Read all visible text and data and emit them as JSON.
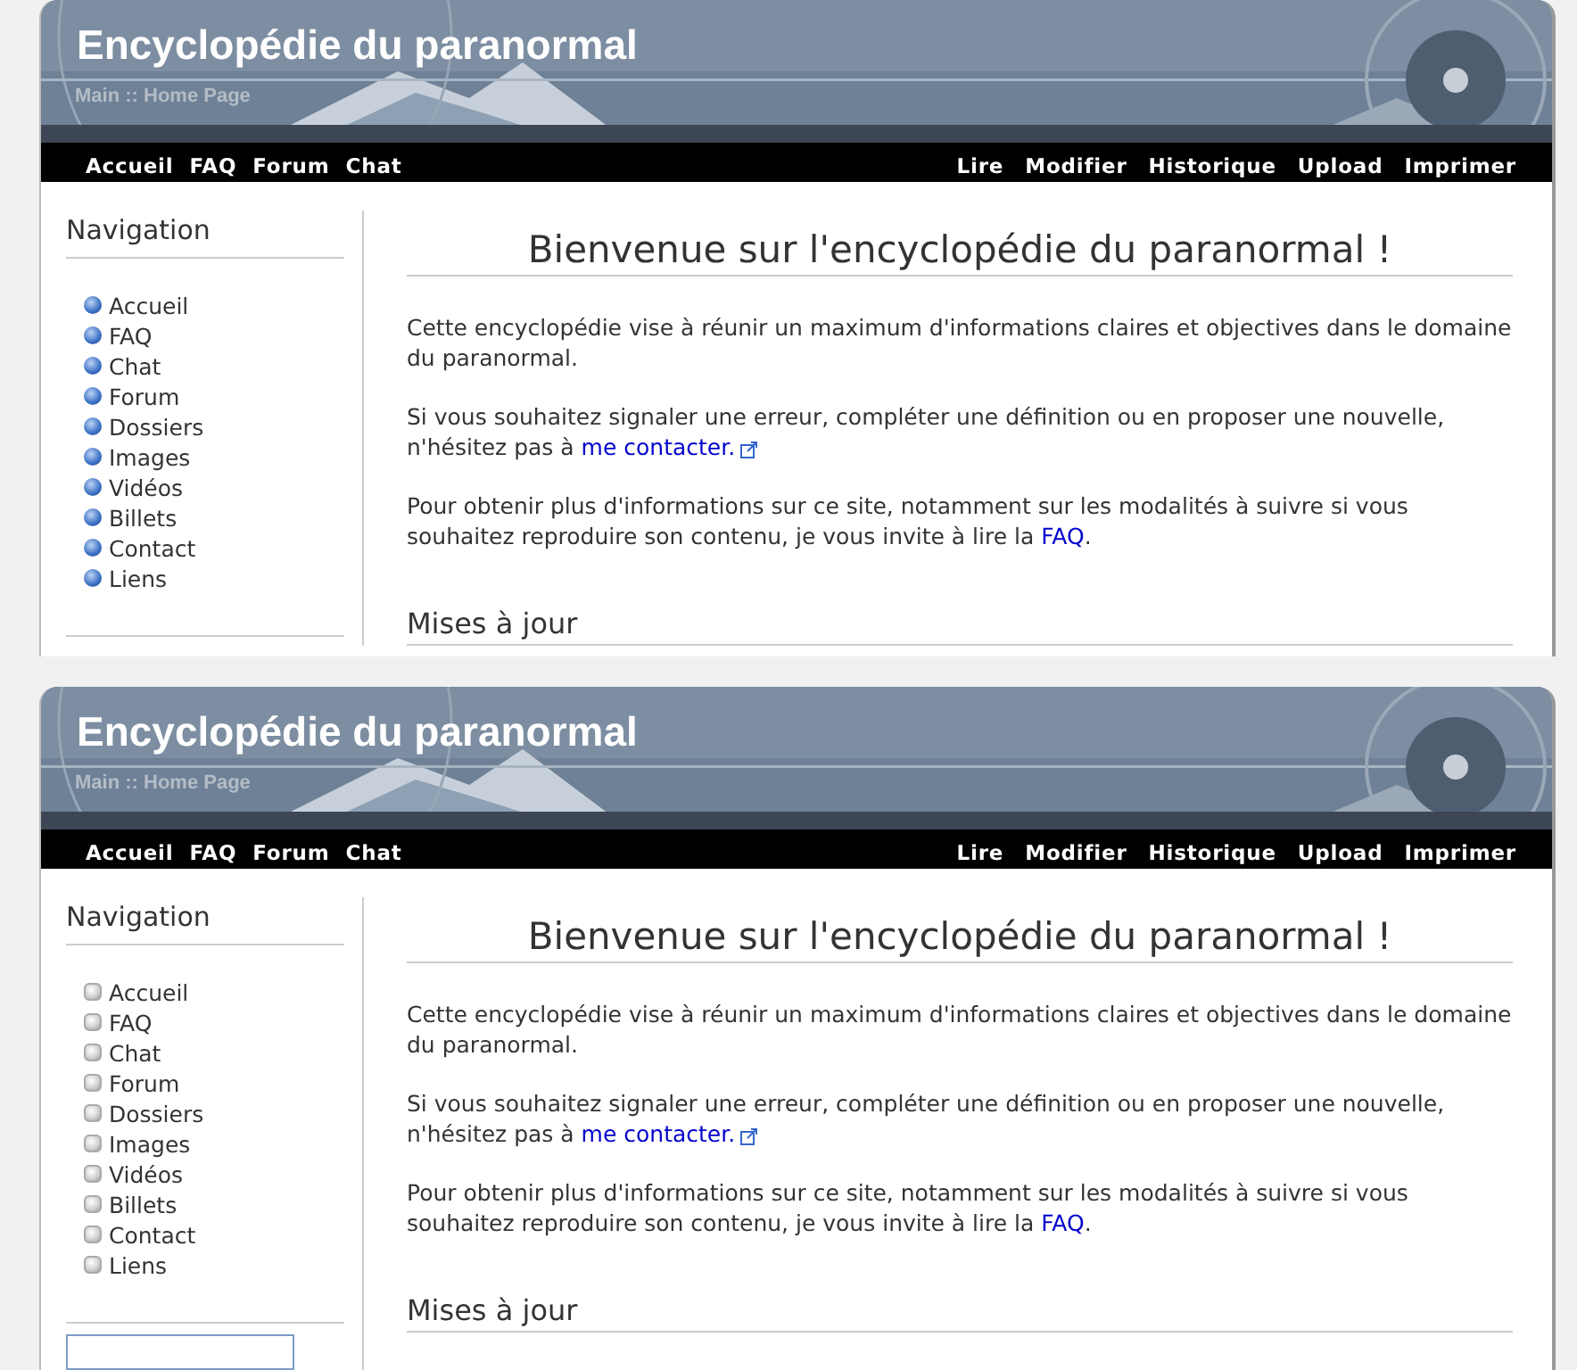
{
  "panels": [
    {
      "kind": "colored",
      "site_title": "Encyclopédie du paranormal",
      "breadcrumb": "Main :: Home Page",
      "top_nav_left": [
        "Accueil",
        "FAQ",
        "Forum",
        "Chat"
      ],
      "top_nav_right": [
        "Lire",
        "Modifier",
        "Historique",
        "Upload",
        "Imprimer"
      ],
      "sidebar": {
        "title": "Navigation",
        "items": [
          "Accueil",
          "FAQ",
          "Chat",
          "Forum",
          "Dossiers",
          "Images",
          "Vidéos",
          "Billets",
          "Contact",
          "Liens"
        ]
      },
      "heading": "Bienvenue sur l'encyclopédie du paranormal !",
      "paragraphs": [
        {
          "text": "Cette encyclopédie vise à réunir un maximum d'informations claires et objectives dans le domaine du paranormal."
        },
        {
          "text": "Si vous souhaitez signaler une erreur, compléter une définition ou en proposer une nouvelle, n'hésitez pas à ",
          "link": "me contacter.",
          "external": true
        },
        {
          "text": "Pour obtenir plus d'informations sur ce site, notamment sur les modalités à suivre si vous souhaitez reproduire son contenu, je vous invite à lire la ",
          "link": "FAQ",
          "external": false,
          "after": "."
        }
      ],
      "subheading": "Mises à jour"
    },
    {
      "kind": "plain",
      "site_title": "Encyclopédie du paranormal",
      "breadcrumb": "Main :: Home Page",
      "top_nav_left": [
        "Accueil",
        "FAQ",
        "Forum",
        "Chat"
      ],
      "top_nav_right": [
        "Lire",
        "Modifier",
        "Historique",
        "Upload",
        "Imprimer"
      ],
      "sidebar": {
        "title": "Navigation",
        "items": [
          "Accueil",
          "FAQ",
          "Chat",
          "Forum",
          "Dossiers",
          "Images",
          "Vidéos",
          "Billets",
          "Contact",
          "Liens"
        ],
        "search_field": true
      },
      "heading": "Bienvenue sur l'encyclopédie du paranormal !",
      "paragraphs": [
        {
          "text": "Cette encyclopédie vise à réunir un maximum d'informations claires et objectives dans le domaine du paranormal."
        },
        {
          "text": "Si vous souhaitez signaler une erreur, compléter une définition ou en proposer une nouvelle, n'hésitez pas à ",
          "link": "me contacter.",
          "external": true
        },
        {
          "text": "Pour obtenir plus d'informations sur ce site, notamment sur les modalités à suivre si vous souhaitez reproduire son contenu, je vous invite à lire la ",
          "link": "FAQ",
          "external": false,
          "after": "."
        }
      ],
      "subheading": "Mises à jour"
    }
  ]
}
